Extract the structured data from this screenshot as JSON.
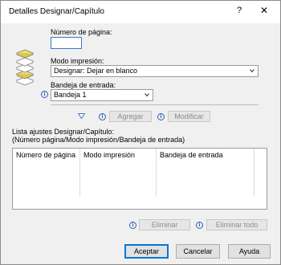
{
  "window": {
    "title": "Detalles Designar/Capítulo",
    "help_glyph": "?",
    "close_glyph": "✕"
  },
  "page_number": {
    "label": "Número de página:",
    "value": ""
  },
  "print_mode": {
    "label": "Modo impresión:",
    "selected": "Designar: Dejar en blanco"
  },
  "input_tray": {
    "label": "Bandeja de entrada:",
    "selected": "Bandeja 1"
  },
  "buttons": {
    "add": "Agregar",
    "modify": "Modificar",
    "delete": "Eliminar",
    "delete_all": "Eliminar todo",
    "accept": "Aceptar",
    "cancel": "Cancelar",
    "help": "Ayuda"
  },
  "list": {
    "title": "Lista ajustes Designar/Capítulo:",
    "subtitle": "(Número página/Modo impresión/Bandeja de entrada)",
    "columns": [
      "Número de página",
      "Modo impresión",
      "Bandeja de entrada"
    ],
    "rows": []
  },
  "icons": {
    "pages": "stacked-pages-icon",
    "info": "info-icon",
    "down_arrow": "down-arrow-icon"
  }
}
